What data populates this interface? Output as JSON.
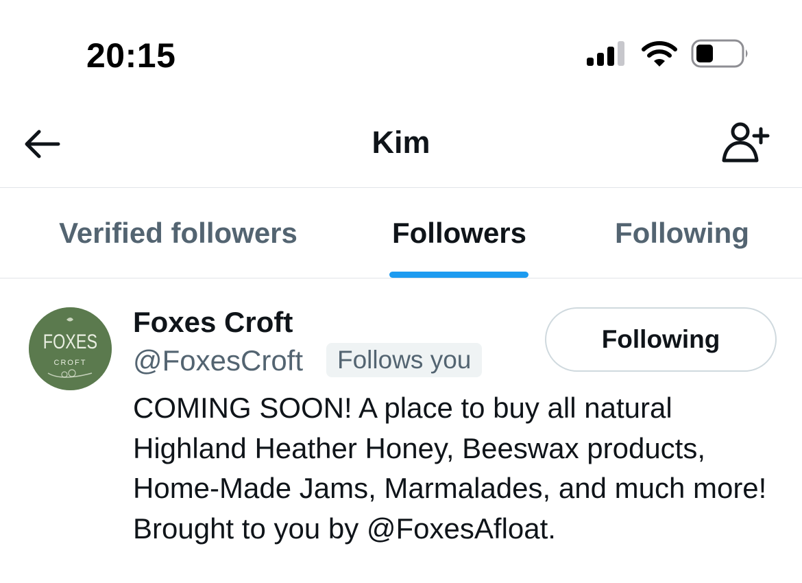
{
  "status_bar": {
    "time": "20:15",
    "icons": [
      "signal-icon",
      "wifi-icon",
      "battery-icon"
    ]
  },
  "header": {
    "title": "Kim",
    "back_icon": "arrow-left-icon",
    "action_icon": "add-user-icon"
  },
  "tabs": [
    {
      "label": "Verified followers",
      "active": false
    },
    {
      "label": "Followers",
      "active": true
    },
    {
      "label": "Following",
      "active": false
    }
  ],
  "followers": [
    {
      "name": "Foxes Croft",
      "handle": "@FoxesCroft",
      "badge": "Follows you",
      "button_label": "Following",
      "bio": "COMING SOON! A place to buy all natural Highland Heather Honey, Beeswax products, Home-Made Jams, Marmalades, and much more! Brought to you by @FoxesAfloat.",
      "avatar": {
        "logo_text": "FOXES",
        "logo_subtext": "CROFT",
        "color": "#5b7a4e"
      }
    }
  ],
  "colors": {
    "accent": "#1d9bf0",
    "primary_text": "#0f1419",
    "secondary_text": "#536471",
    "divider": "#e1e4e8"
  }
}
